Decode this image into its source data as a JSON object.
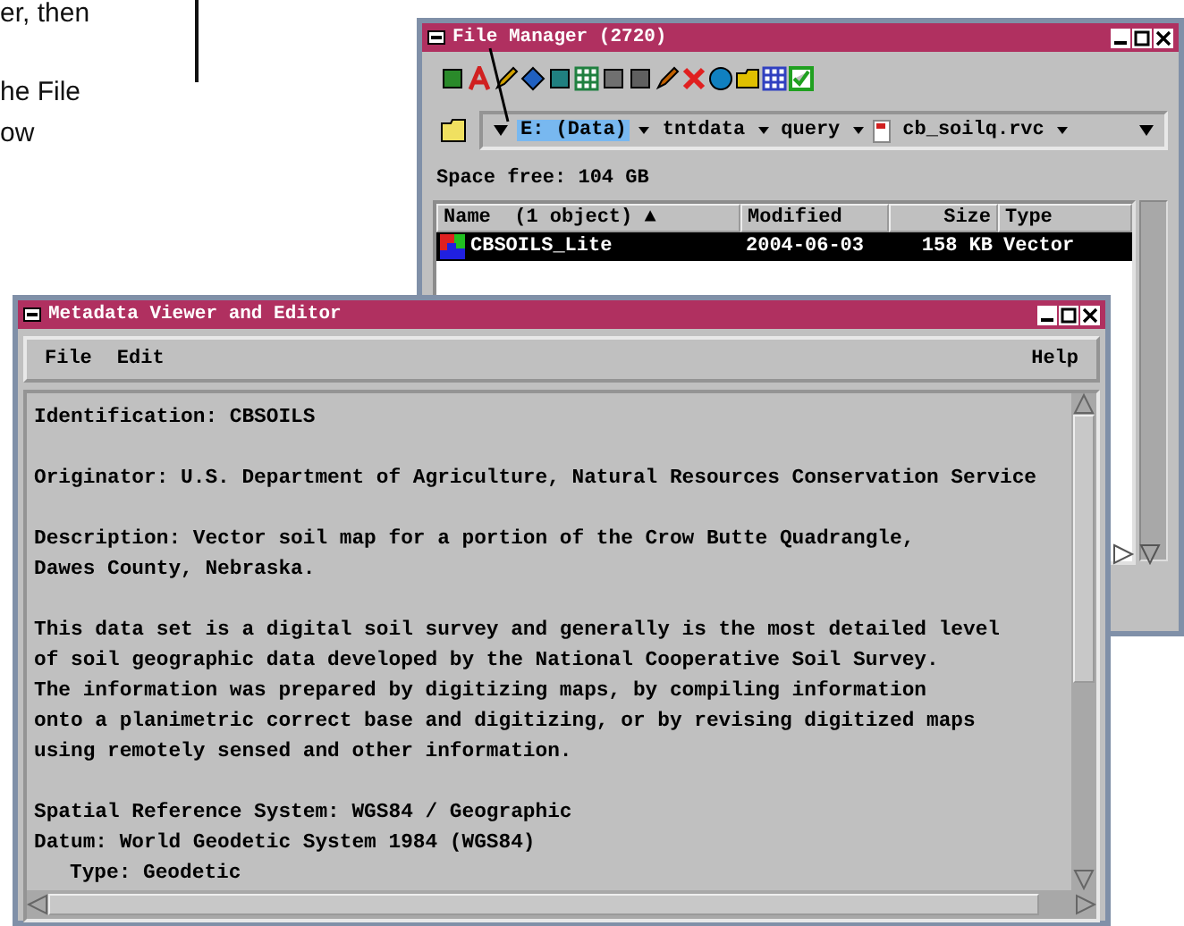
{
  "page_text": {
    "lines": [
      "er, then",
      "he File",
      "ow"
    ]
  },
  "file_manager": {
    "title": "File Manager (2720)",
    "path": [
      {
        "label": "E: (Data)",
        "selected": true
      },
      {
        "label": "tntdata",
        "selected": false
      },
      {
        "label": "query",
        "selected": false
      },
      {
        "label": "cb_soilq.rvc",
        "selected": false
      }
    ],
    "space_free": "Space free: 104 GB",
    "columns": [
      "Name  (1 object) ▲",
      "Modified",
      "Size",
      "Type"
    ],
    "rows": [
      {
        "name": "CBSOILS_Lite",
        "modified": "2004-06-03",
        "size": "158 KB",
        "type": "Vector",
        "selected": true
      }
    ]
  },
  "metadata_viewer": {
    "title": "Metadata Viewer and Editor",
    "menu": [
      "File",
      "Edit",
      "Help"
    ],
    "paragraphs": [
      {
        "lines": [
          {
            "text": "Identification: CBSOILS"
          }
        ]
      },
      {
        "lines": [
          {
            "text": "Originator: U.S. Department of Agriculture, Natural Resources Conservation Service"
          }
        ]
      },
      {
        "lines": [
          {
            "text": "Description: Vector soil map for a portion of the Crow Butte Quadrangle,"
          },
          {
            "text": "Dawes County, Nebraska."
          }
        ]
      },
      {
        "lines": [
          {
            "text": "This data set is a digital soil survey and generally is the most detailed level"
          },
          {
            "text": "of soil geographic data developed by the National Cooperative Soil Survey."
          },
          {
            "text": "The information was prepared by digitizing maps, by compiling information"
          },
          {
            "text": "onto a planimetric correct base and digitizing, or by revising digitized maps"
          },
          {
            "text": "using remotely sensed and other information."
          }
        ]
      },
      {
        "lines": [
          {
            "text": "Spatial Reference System: WGS84 / Geographic"
          },
          {
            "text": "Datum: World Geodetic System 1984 (WGS84)",
            "children": [
              {
                "text": "Type: Geodetic"
              }
            ]
          }
        ]
      }
    ]
  }
}
